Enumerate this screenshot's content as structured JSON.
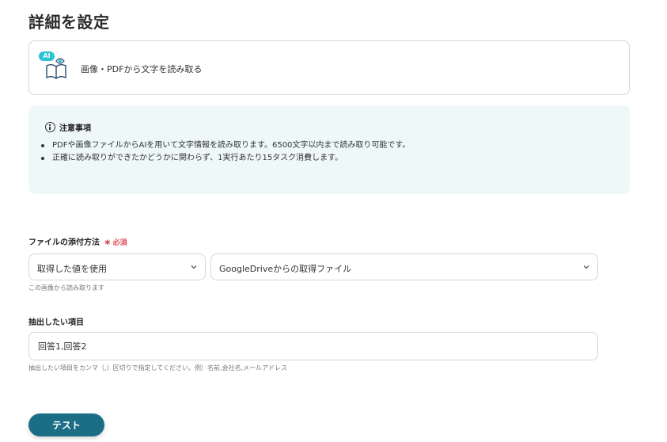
{
  "page": {
    "title": "詳細を設定"
  },
  "action": {
    "badge": "AI",
    "label": "画像・PDFから文字を読み取る",
    "icon": "ai-book-eye-icon"
  },
  "notice": {
    "title": "注意事項",
    "items": [
      "PDFや画像ファイルからAIを用いて文字情報を読み取ります。6500文字以内まで読み取り可能です。",
      "正確に読み取りができたかどうかに関わらず、1実行あたり15タスク消費します。"
    ]
  },
  "attachment": {
    "label": "ファイルの添付方法",
    "required": "✱ 必須",
    "method_value": "取得した値を使用",
    "source_value": "GoogleDriveからの取得ファイル",
    "hint": "この画像から読み取ります"
  },
  "extract": {
    "label": "抽出したい項目",
    "value": "回答1,回答2",
    "hint": "抽出したい項目をカンマ（,）区切りで指定してください。例）名前,会社名,メールアドレス"
  },
  "test_button": {
    "label": "テスト"
  },
  "colors": {
    "accent": "#1b6e86",
    "notice_bg": "#eef8f8",
    "required": "#e04a5a",
    "ai_badge": "#29c2d6"
  }
}
